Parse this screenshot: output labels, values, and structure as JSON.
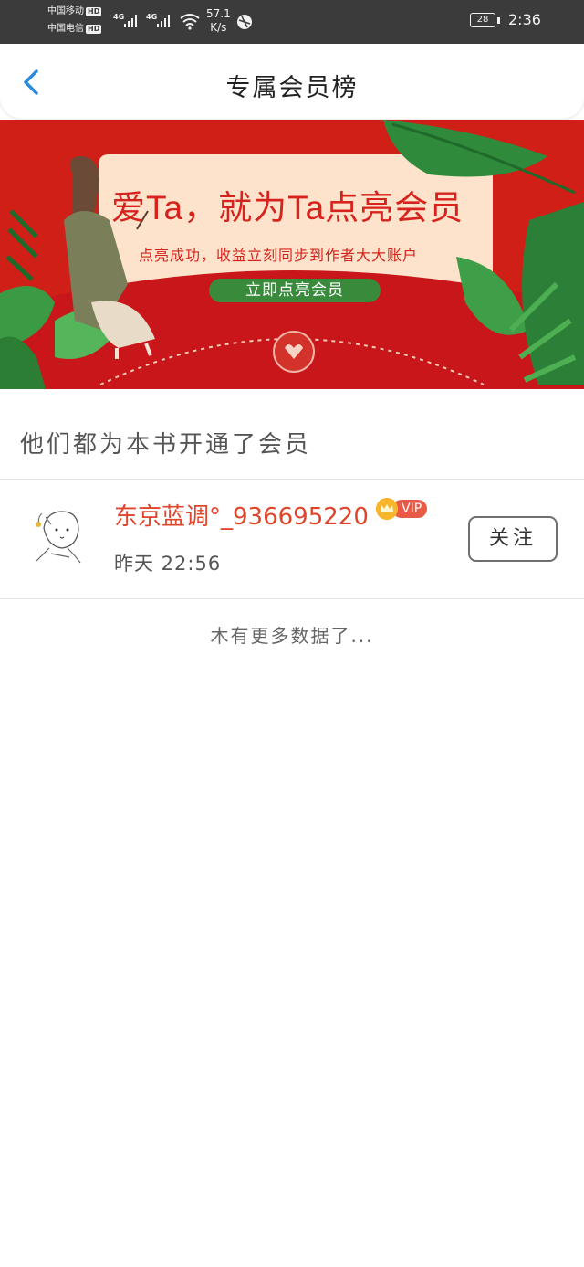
{
  "status_bar": {
    "carrier1": "中国移动",
    "carrier2": "中国电信",
    "hd_badge": "HD",
    "network_type": "4G",
    "net_speed_value": "57.1",
    "net_speed_unit": "K/s",
    "battery_level": "28",
    "time": "2:36"
  },
  "header": {
    "back_icon": "chevron-left-icon",
    "title": "专属会员榜"
  },
  "banner": {
    "title": "爱Ta，就为Ta点亮会员",
    "subtitle": "点亮成功，收益立刻同步到作者大大账户",
    "button_label": "立即点亮会员"
  },
  "section": {
    "heading": "他们都为本书开通了会员"
  },
  "members": [
    {
      "name": "东京蓝调°_936695220",
      "badge": "VIP",
      "time": "昨天 22:56",
      "follow_label": "关注"
    }
  ],
  "footer": {
    "no_more_text": "木有更多数据了..."
  },
  "colors": {
    "accent": "#2a8ae0",
    "banner_red": "#cf1f17",
    "name_red": "#e0452c",
    "status_bar_bg": "#3b3b3b"
  }
}
